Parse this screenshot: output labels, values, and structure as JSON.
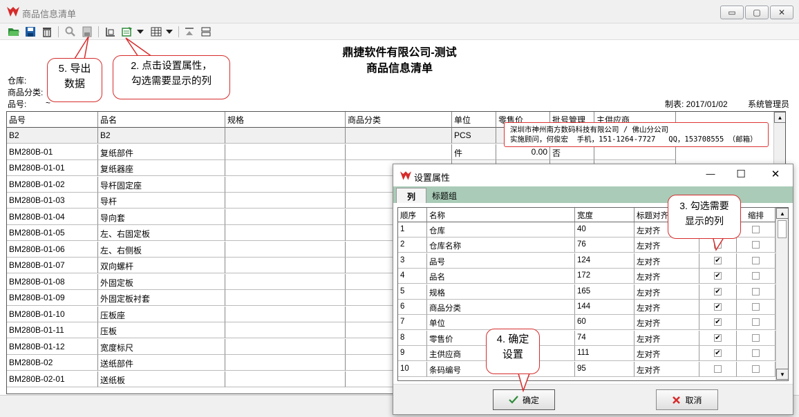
{
  "window": {
    "title": "商品信息清单",
    "controls": {
      "minimize": "▭",
      "maximize": "▢",
      "close": "✕"
    }
  },
  "report": {
    "company": "鼎捷软件有限公司-测试",
    "title": "商品信息清单",
    "filter_labels": [
      "仓库:",
      "商品分类:",
      "品号:"
    ],
    "part_tilde": "~",
    "maker": "制表: 2017/01/02",
    "user": "系统管理员"
  },
  "grid": {
    "columns": [
      "品号",
      "品名",
      "规格",
      "商品分类",
      "单位",
      "零售价",
      "批号管理",
      "主供应商"
    ],
    "rows": [
      [
        "B2",
        "B2",
        "",
        "",
        "PCS",
        "",
        "",
        ""
      ],
      [
        "BM280B-01",
        "复纸部件",
        "",
        "",
        "件",
        "0.00",
        "否",
        ""
      ],
      [
        "BM280B-01-01",
        "复纸器座",
        "",
        "",
        "",
        "",
        "",
        ""
      ],
      [
        "BM280B-01-02",
        "导杆固定座",
        "",
        "",
        "",
        "",
        "",
        ""
      ],
      [
        "BM280B-01-03",
        "导杆",
        "",
        "",
        "",
        "",
        "",
        ""
      ],
      [
        "BM280B-01-04",
        "导向套",
        "",
        "",
        "",
        "",
        "",
        ""
      ],
      [
        "BM280B-01-05",
        "左、右固定板",
        "",
        "",
        "",
        "",
        "",
        ""
      ],
      [
        "BM280B-01-06",
        "左、右侧板",
        "",
        "",
        "",
        "",
        "",
        ""
      ],
      [
        "BM280B-01-07",
        "双向螺杆",
        "",
        "",
        "",
        "",
        "",
        ""
      ],
      [
        "BM280B-01-08",
        "外固定板",
        "",
        "",
        "",
        "",
        "",
        ""
      ],
      [
        "BM280B-01-09",
        "外固定板衬套",
        "",
        "",
        "",
        "",
        "",
        ""
      ],
      [
        "BM280B-01-10",
        "压板座",
        "",
        "",
        "",
        "",
        "",
        ""
      ],
      [
        "BM280B-01-11",
        "压板",
        "",
        "",
        "",
        "",
        "",
        ""
      ],
      [
        "BM280B-01-12",
        "宽度标尺",
        "",
        "",
        "",
        "",
        "",
        ""
      ],
      [
        "BM280B-02",
        "送纸部件",
        "",
        "",
        "",
        "",
        "",
        ""
      ],
      [
        "BM280B-02-01",
        "送纸板",
        "",
        "",
        "",
        "",
        "",
        ""
      ]
    ]
  },
  "tooltip": {
    "line1": "深圳市神州南方数码科技有限公司 / 佛山分公司",
    "line2": "实施顾问，何俊宏  手机，151-1264-7727   QQ，153708555 （邮箱）"
  },
  "dialog": {
    "title": "设置属性",
    "controls": {
      "minimize": "—",
      "maximize": "☐",
      "close": "✕"
    },
    "tabs": [
      "列",
      "标题组"
    ],
    "columns": [
      "顺序",
      "名称",
      "宽度",
      "标题对齐",
      "",
      "缩排"
    ],
    "rows": [
      {
        "order": "1",
        "name": "仓库",
        "width": "40",
        "align": "左对齐",
        "visible": false,
        "indent": false
      },
      {
        "order": "2",
        "name": "仓库名称",
        "width": "76",
        "align": "左对齐",
        "visible": false,
        "indent": false
      },
      {
        "order": "3",
        "name": "品号",
        "width": "124",
        "align": "左对齐",
        "visible": true,
        "indent": false
      },
      {
        "order": "4",
        "name": "品名",
        "width": "172",
        "align": "左对齐",
        "visible": true,
        "indent": false
      },
      {
        "order": "5",
        "name": "规格",
        "width": "165",
        "align": "左对齐",
        "visible": true,
        "indent": false
      },
      {
        "order": "6",
        "name": "商品分类",
        "width": "144",
        "align": "左对齐",
        "visible": true,
        "indent": false
      },
      {
        "order": "7",
        "name": "单位",
        "width": "60",
        "align": "左对齐",
        "visible": true,
        "indent": false
      },
      {
        "order": "8",
        "name": "零售价",
        "width": "74",
        "align": "左对齐",
        "visible": true,
        "indent": false
      },
      {
        "order": "9",
        "name": "主供应商",
        "width": "111",
        "align": "左对齐",
        "visible": true,
        "indent": false
      },
      {
        "order": "10",
        "name": "条码编号",
        "width": "95",
        "align": "左对齐",
        "visible": false,
        "indent": false
      }
    ],
    "ok_label": "确定",
    "cancel_label": "取消"
  },
  "callouts": {
    "export": "5. 导出\n数据",
    "set_props": "2. 点击设置属性，\n勾选需要显示的列",
    "check_cols": "3. 勾选需要\n显示的列",
    "confirm": "4. 确定\n设置"
  },
  "colors": {
    "brand_red": "#d62b2b",
    "tab_bar": "#a9cbb7",
    "callout_border": "#d62b2b"
  }
}
